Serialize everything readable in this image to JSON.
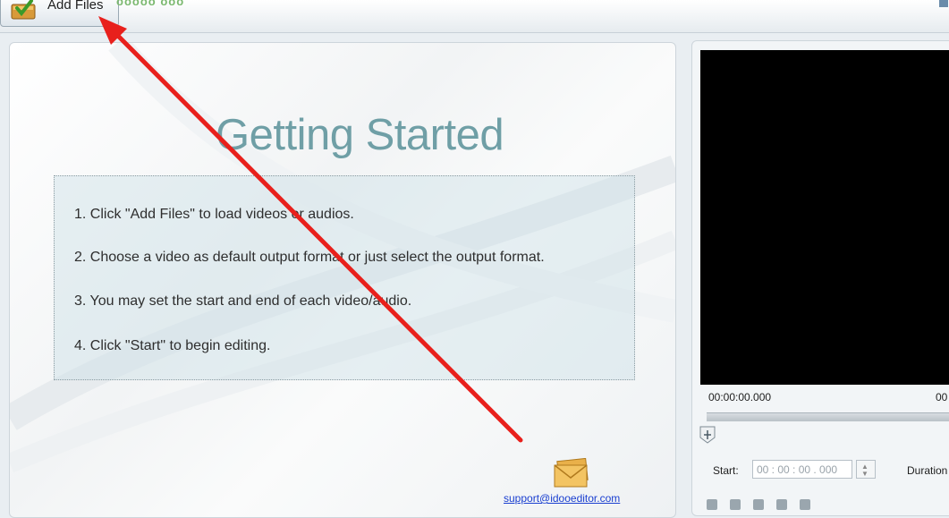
{
  "toolbar": {
    "add_files_label": "Add Files",
    "ghost_text": "ooooo ooo"
  },
  "getting_started": {
    "title": "Getting Started",
    "steps": [
      "1. Click \"Add Files\" to load videos or audios.",
      "2. Choose a video as default output format or just select the output format.",
      "3. You may set the start and end of each video/audio.",
      "4. Click \"Start\" to begin editing."
    ]
  },
  "support": {
    "email": "support@idooeditor.com",
    "icon": "envelope-icon"
  },
  "player": {
    "time_start": "00:00:00.000",
    "time_end": "00",
    "start_label": "Start:",
    "start_value": "00 : 00 : 00 . 000",
    "duration_label": "Duration"
  },
  "colors": {
    "title": "#6f9fa6",
    "link": "#1a3fd0",
    "arrow": "#e8201c",
    "video_bg": "#000000"
  }
}
